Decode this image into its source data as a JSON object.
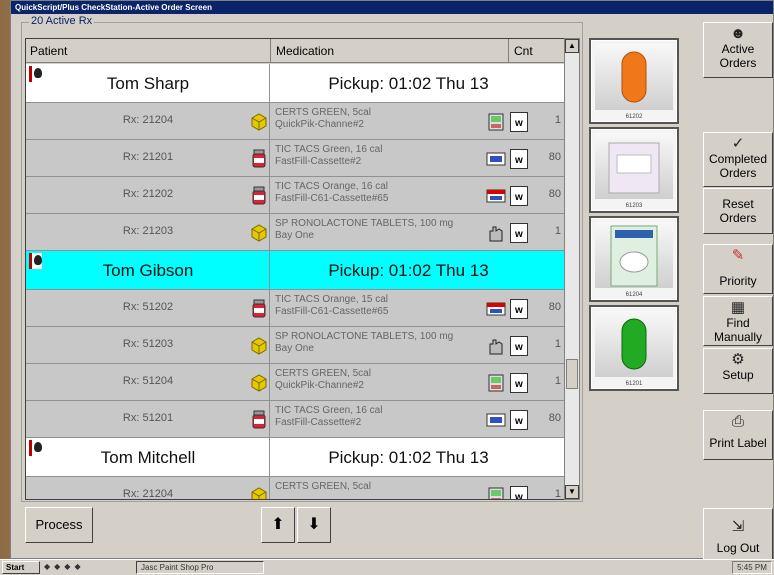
{
  "window": {
    "title": "QuickScript/Plus CheckStation-Active Order Screen"
  },
  "group_label": "20 Active Rx",
  "columns": {
    "patient": "Patient",
    "medication": "Medication",
    "count": "Cnt"
  },
  "rows": [
    {
      "kind": "patient",
      "name": "Tom Sharp",
      "pickup": "Pickup: 01:02 Thu 13",
      "selected": false
    },
    {
      "kind": "rx",
      "rx": "Rx: 21204",
      "container": "box",
      "med1": "CERTS GREEN, 5cal",
      "med2": "QuickPik-Channe#2",
      "icon": "scale-icon",
      "count": "1"
    },
    {
      "kind": "rx",
      "rx": "Rx: 21201",
      "container": "bottle",
      "med1": "TIC TACS Green, 16 cal",
      "med2": "FastFill-Cassette#2",
      "icon": "cassette-icon",
      "count": "80"
    },
    {
      "kind": "rx",
      "rx": "Rx: 21202",
      "container": "bottle",
      "med1": "TIC TACS Orange, 16 cal",
      "med2": "FastFill-C61-Cassette#65",
      "icon": "cassette-red-icon",
      "count": "80"
    },
    {
      "kind": "rx",
      "rx": "Rx: 21203",
      "container": "box",
      "med1": "SP RONOLACTONE TABLETS, 100 mg",
      "med2": "Bay One",
      "icon": "hand-icon",
      "count": "1"
    },
    {
      "kind": "patient",
      "name": "Tom Gibson",
      "pickup": "Pickup: 01:02 Thu 13",
      "selected": true
    },
    {
      "kind": "rx",
      "rx": "Rx: 51202",
      "container": "bottle",
      "med1": "TIC TACS Orange, 15 cal",
      "med2": "FastFill-C61-Cassette#65",
      "icon": "cassette-red-icon",
      "count": "80"
    },
    {
      "kind": "rx",
      "rx": "Rx: 51203",
      "container": "box",
      "med1": "SP RONOLACTONE TABLETS, 100 mg",
      "med2": "Bay One",
      "icon": "hand-icon",
      "count": "1"
    },
    {
      "kind": "rx",
      "rx": "Rx: 51204",
      "container": "box",
      "med1": "CERTS GREEN, 5cal",
      "med2": "QuickPik-Channe#2",
      "icon": "scale-icon",
      "count": "1"
    },
    {
      "kind": "rx",
      "rx": "Rx: 51201",
      "container": "bottle",
      "med1": "TIC TACS Green, 16 cal",
      "med2": "FastFill-Cassette#2",
      "icon": "cassette-icon",
      "count": "80"
    },
    {
      "kind": "patient",
      "name": "Tom Mitchell",
      "pickup": "Pickup: 01:02 Thu 13",
      "selected": false
    },
    {
      "kind": "rx",
      "rx": "Rx: 21204",
      "container": "box",
      "med1": "CERTS GREEN, 5cal",
      "med2": "",
      "icon": "scale-icon",
      "count": "1"
    }
  ],
  "thumbnails": [
    {
      "caption": "61202",
      "image": "orange-capsule"
    },
    {
      "caption": "61203",
      "image": "white-bottle"
    },
    {
      "caption": "61204",
      "image": "certs-package"
    },
    {
      "caption": "61201",
      "image": "green-capsule"
    }
  ],
  "sidebar": {
    "active_orders": "Active Orders",
    "completed_orders": "Completed Orders",
    "reset_orders": "Reset Orders",
    "priority": "Priority",
    "find_manually": "Find Manually",
    "setup": "Setup",
    "print_label": "Print Label",
    "log_out": "Log Out"
  },
  "bottom": {
    "process": "Process",
    "up": "⬆",
    "down": "⬇"
  },
  "taskbar": {
    "start": "Start",
    "task": "Jasc Paint Shop Pro",
    "clock": "5:45 PM"
  },
  "colors": {
    "selected_row": "#00ffff",
    "titlebar": "#0a246a",
    "patient_marker": "#c00000"
  }
}
